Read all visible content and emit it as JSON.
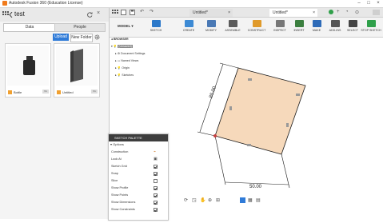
{
  "window": {
    "title": "Autodesk Fusion 360 (Education License)"
  },
  "data_panel": {
    "project_title": "test",
    "tabs": [
      "Data",
      "People"
    ],
    "upload_label": "Upload",
    "new_folder_label": "New Folder",
    "items": [
      {
        "name": "Bottle",
        "badge": "V1"
      },
      {
        "name": "Untitled",
        "badge": "V1"
      }
    ]
  },
  "doc_tabs": [
    {
      "label": "Untitled*",
      "active": false
    },
    {
      "label": "Untitled*",
      "active": true
    }
  ],
  "toolbar": {
    "model_label": "MODEL",
    "items": [
      {
        "label": "SKETCH",
        "icon": "sketch-icon",
        "color": "#2b78c9"
      },
      {
        "label": "CREATE",
        "icon": "create-icon",
        "color": "#3d8ad4"
      },
      {
        "label": "MODIFY",
        "icon": "modify-icon",
        "color": "#4a79b5"
      },
      {
        "label": "ASSEMBLE",
        "icon": "assemble-icon",
        "color": "#5a5a5a"
      },
      {
        "label": "CONSTRUCT",
        "icon": "construct-icon",
        "color": "#e09a2a"
      },
      {
        "label": "INSPECT",
        "icon": "inspect-icon",
        "color": "#777777"
      },
      {
        "label": "INSERT",
        "icon": "insert-icon",
        "color": "#3b7f3f"
      },
      {
        "label": "MAKE",
        "icon": "make-icon",
        "color": "#2e6bb8"
      },
      {
        "label": "ADD-INS",
        "icon": "addins-icon",
        "color": "#555555"
      },
      {
        "label": "SELECT",
        "icon": "select-icon",
        "color": "#444444"
      },
      {
        "label": "STOP SKETCH",
        "icon": "stop-sketch-icon",
        "color": "#2fa04a"
      }
    ]
  },
  "browser": {
    "title": "BROWSER",
    "items": [
      "(Unsaved)",
      "Document Settings",
      "Named Views",
      "Origin",
      "Sketches"
    ]
  },
  "sketch_palette": {
    "title": "SKETCH PALETTE",
    "section": "Options",
    "rows": [
      {
        "label": "Construction",
        "checked": null
      },
      {
        "label": "Look At",
        "checked": null
      },
      {
        "label": "Sketch Grid",
        "checked": true
      },
      {
        "label": "Snap",
        "checked": true
      },
      {
        "label": "Slice",
        "checked": false
      },
      {
        "label": "Show Profile",
        "checked": true
      },
      {
        "label": "Show Points",
        "checked": true
      },
      {
        "label": "Show Dimensions",
        "checked": true
      },
      {
        "label": "Show Constraints",
        "checked": true
      }
    ]
  },
  "sketch": {
    "dim_height": "85.00",
    "dim_width": "50.00"
  },
  "colors": {
    "accent": "#2f7bd8",
    "profile_fill": "#f6d9bb",
    "sketch_line": "#1b1b1b"
  }
}
